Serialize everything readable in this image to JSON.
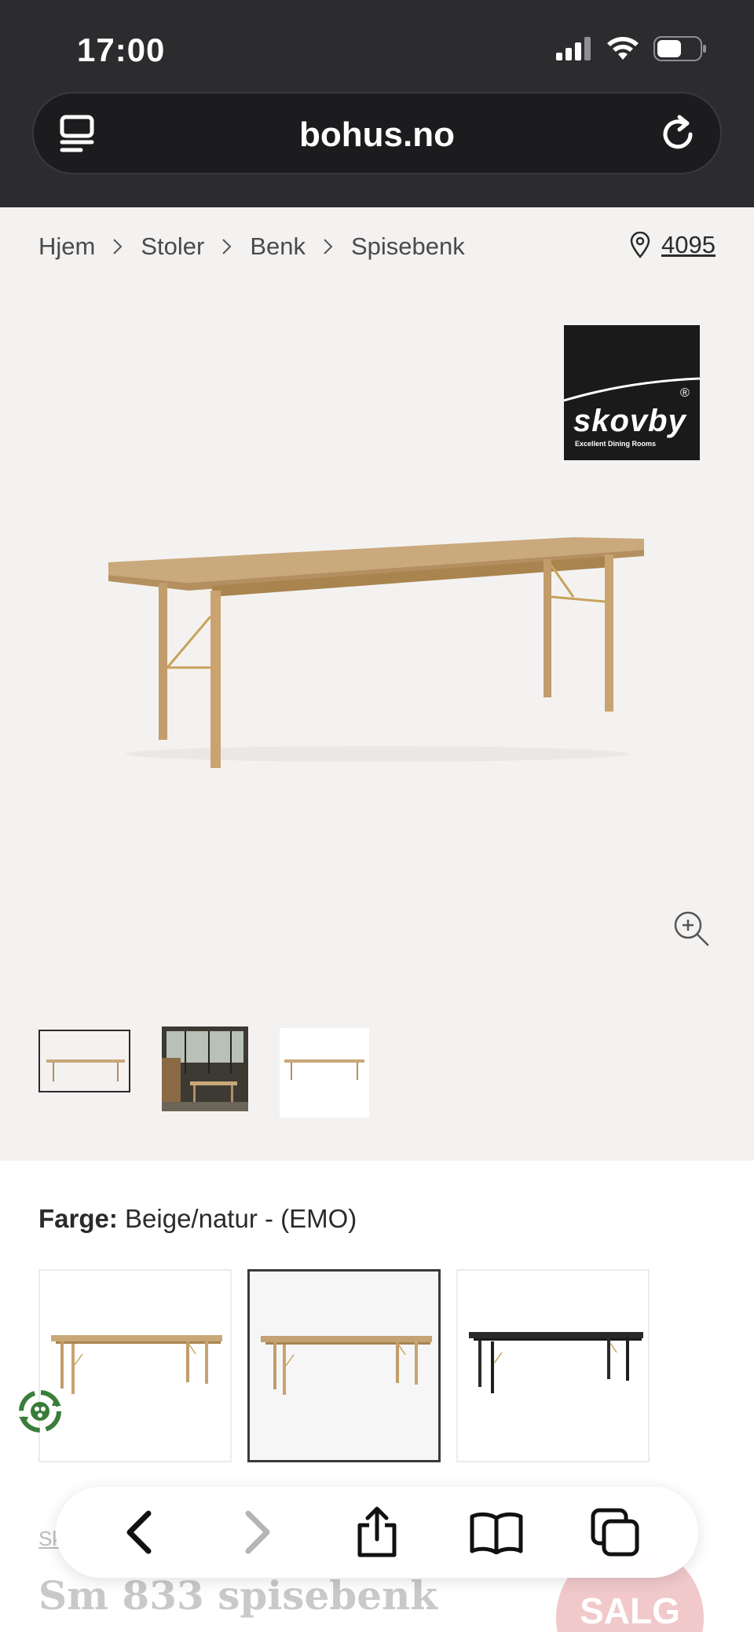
{
  "status_bar": {
    "time": "17:00"
  },
  "browser": {
    "url": "bohus.no"
  },
  "breadcrumb": {
    "items": [
      "Hjem",
      "Stoler",
      "Benk",
      "Spisebenk"
    ]
  },
  "store": {
    "code": "4095"
  },
  "brand": {
    "name": "skovby",
    "tagline": "Excellent Dining Rooms",
    "registered": "®"
  },
  "color_selector": {
    "label": "Farge:",
    "value": "Beige/natur - (EMO)",
    "options": [
      {
        "name": "oak-light",
        "color": "#c9a878"
      },
      {
        "name": "beige-natur-emo",
        "color": "#c4a273",
        "selected": true
      },
      {
        "name": "black",
        "color": "#2a2a2a"
      }
    ]
  },
  "product": {
    "brand_link": "Sk",
    "title": "Sm 833 spisebenk",
    "sale_label": "SALG"
  },
  "colors": {
    "top_bar": "#2c2c2e",
    "page_bg": "#f4f2f1",
    "wood": "#c9a878",
    "brass": "#c7a35a",
    "sale": "#f1c9cb"
  }
}
